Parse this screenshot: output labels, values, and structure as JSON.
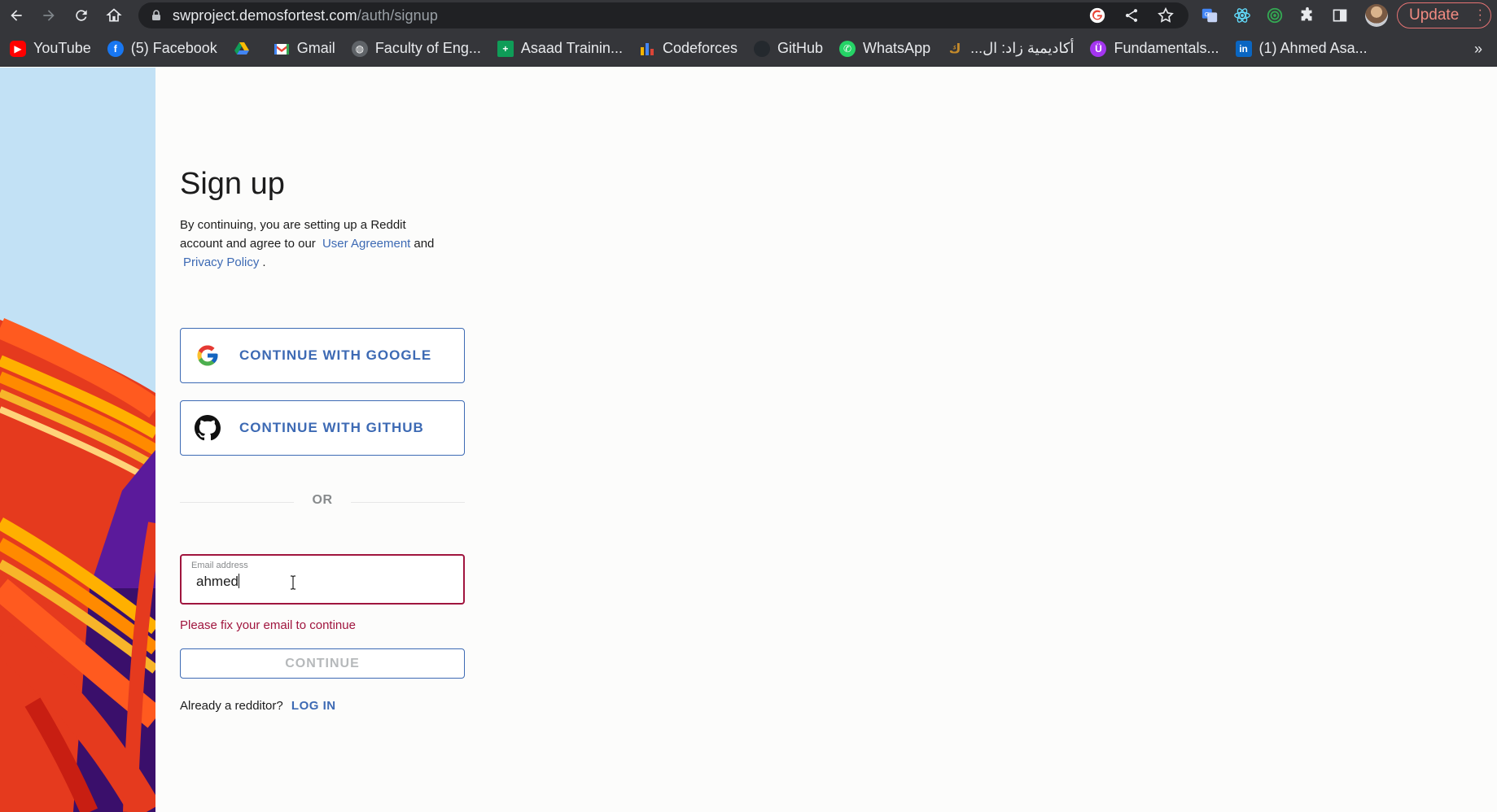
{
  "browser": {
    "url_host": "swproject.demosfortest.com",
    "url_path": "/auth/signup",
    "update_label": "Update"
  },
  "bookmarks": [
    {
      "label": "YouTube",
      "icon": "youtube-icon",
      "color": "#ff0000"
    },
    {
      "label": "(5) Facebook",
      "icon": "facebook-icon",
      "color": "#1877f2"
    },
    {
      "label": "",
      "icon": "google-drive-icon",
      "color": "#0f9d58"
    },
    {
      "label": "Gmail",
      "icon": "gmail-icon",
      "color": "#ea4335"
    },
    {
      "label": "Faculty of Eng...",
      "icon": "globe-icon",
      "color": "#5f6368"
    },
    {
      "label": "Asaad Trainin...",
      "icon": "sheets-icon",
      "color": "#0f9d58"
    },
    {
      "label": "Codeforces",
      "icon": "codeforces-icon",
      "color": "#f4b400"
    },
    {
      "label": "GitHub",
      "icon": "github-icon",
      "color": "#24292e"
    },
    {
      "label": "WhatsApp",
      "icon": "whatsapp-icon",
      "color": "#25d366"
    },
    {
      "label": "أكاديمية زاد: ال...",
      "icon": "zad-icon",
      "color": "#c58b2b"
    },
    {
      "label": "Fundamentals...",
      "icon": "course-icon",
      "color": "#a435f0"
    },
    {
      "label": "(1) Ahmed Asa...",
      "icon": "linkedin-icon",
      "color": "#0a66c2"
    }
  ],
  "signup": {
    "title": "Sign up",
    "agreement_pre": "By continuing, you are setting up a Reddit account and agree to our",
    "user_agreement": "User Agreement",
    "and": "and",
    "privacy_policy": "Privacy Policy",
    "period": ".",
    "google_label": "CONTINUE WITH GOOGLE",
    "github_label": "CONTINUE WITH GITHUB",
    "or_label": "OR",
    "email_label": "Email address",
    "email_value": "ahmed",
    "error": "Please fix your email to continue",
    "continue_label": "CONTINUE",
    "already_text": "Already a redditor?",
    "login_label": "LOG IN"
  },
  "colors": {
    "accent": "#3d6ab4",
    "error": "#a0153e",
    "chrome_bg": "#35363a"
  }
}
